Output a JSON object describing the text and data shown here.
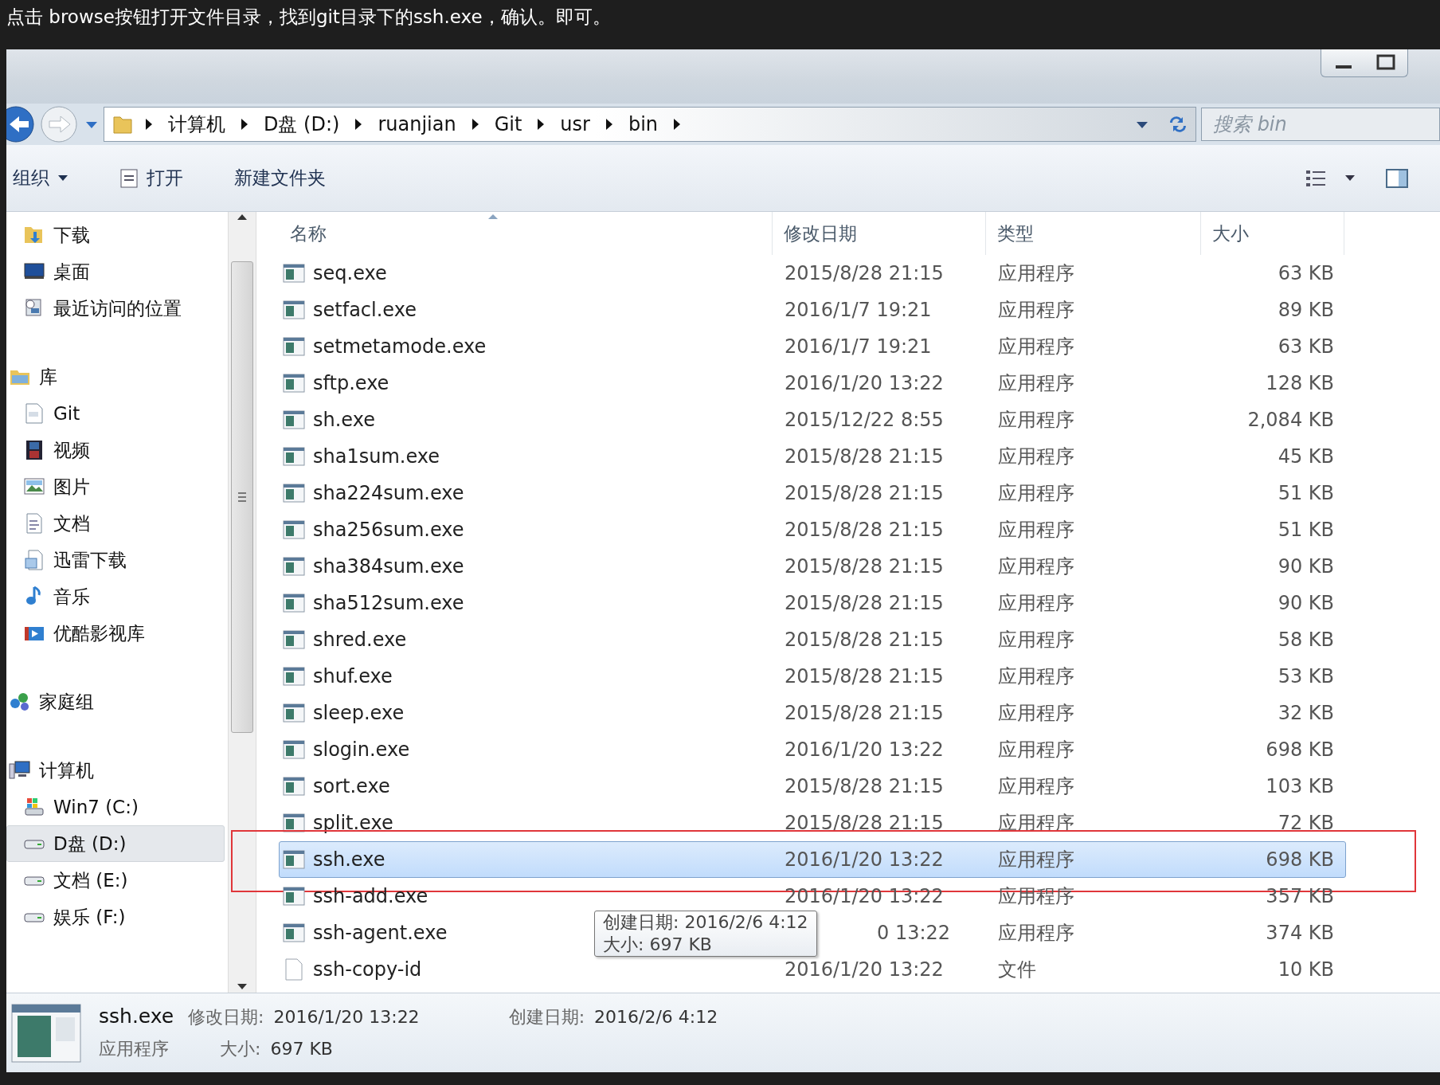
{
  "caption": "点击 browse按钮打开文件目录，找到git目录下的ssh.exe，确认。即可。",
  "address_bar": {
    "breadcrumbs": [
      "计算机",
      "D盘 (D:)",
      "ruanjian",
      "Git",
      "usr",
      "bin"
    ],
    "search": {
      "placeholder": "搜索 bin"
    }
  },
  "toolbar": {
    "buttons": [
      "组织",
      "打开",
      "新建文件夹"
    ]
  },
  "sidebar": {
    "items": [
      {
        "label": "下载",
        "kind": "item",
        "selected": false
      },
      {
        "label": "桌面",
        "kind": "item",
        "selected": false
      },
      {
        "label": "最近访问的位置",
        "kind": "item",
        "selected": false
      },
      {
        "label": "库",
        "kind": "group",
        "selected": false
      },
      {
        "label": "Git",
        "kind": "item",
        "selected": false
      },
      {
        "label": "视频",
        "kind": "item",
        "selected": false
      },
      {
        "label": "图片",
        "kind": "item",
        "selected": false
      },
      {
        "label": "文档",
        "kind": "item",
        "selected": false
      },
      {
        "label": "迅雷下载",
        "kind": "item",
        "selected": false
      },
      {
        "label": "音乐",
        "kind": "item",
        "selected": false
      },
      {
        "label": "优酷影视库",
        "kind": "item",
        "selected": false
      },
      {
        "label": "家庭组",
        "kind": "group",
        "selected": false
      },
      {
        "label": "计算机",
        "kind": "group",
        "selected": false
      },
      {
        "label": "Win7 (C:)",
        "kind": "item",
        "selected": false
      },
      {
        "label": "D盘 (D:)",
        "kind": "item",
        "selected": true
      },
      {
        "label": "文档 (E:)",
        "kind": "item",
        "selected": false
      },
      {
        "label": "娱乐 (F:)",
        "kind": "item",
        "selected": false
      }
    ]
  },
  "file_list": {
    "columns": [
      "名称",
      "修改日期",
      "类型",
      "大小"
    ],
    "rows": [
      {
        "name": "seq.exe",
        "date": "2015/8/28 21:15",
        "type": "应用程序",
        "size": "63 KB",
        "kind": "exe",
        "selected": false
      },
      {
        "name": "setfacl.exe",
        "date": "2016/1/7 19:21",
        "type": "应用程序",
        "size": "89 KB",
        "kind": "exe",
        "selected": false
      },
      {
        "name": "setmetamode.exe",
        "date": "2016/1/7 19:21",
        "type": "应用程序",
        "size": "63 KB",
        "kind": "exe",
        "selected": false
      },
      {
        "name": "sftp.exe",
        "date": "2016/1/20 13:22",
        "type": "应用程序",
        "size": "128 KB",
        "kind": "exe",
        "selected": false
      },
      {
        "name": "sh.exe",
        "date": "2015/12/22 8:55",
        "type": "应用程序",
        "size": "2,084 KB",
        "kind": "exe",
        "selected": false
      },
      {
        "name": "sha1sum.exe",
        "date": "2015/8/28 21:15",
        "type": "应用程序",
        "size": "45 KB",
        "kind": "exe",
        "selected": false
      },
      {
        "name": "sha224sum.exe",
        "date": "2015/8/28 21:15",
        "type": "应用程序",
        "size": "51 KB",
        "kind": "exe",
        "selected": false
      },
      {
        "name": "sha256sum.exe",
        "date": "2015/8/28 21:15",
        "type": "应用程序",
        "size": "51 KB",
        "kind": "exe",
        "selected": false
      },
      {
        "name": "sha384sum.exe",
        "date": "2015/8/28 21:15",
        "type": "应用程序",
        "size": "90 KB",
        "kind": "exe",
        "selected": false
      },
      {
        "name": "sha512sum.exe",
        "date": "2015/8/28 21:15",
        "type": "应用程序",
        "size": "90 KB",
        "kind": "exe",
        "selected": false
      },
      {
        "name": "shred.exe",
        "date": "2015/8/28 21:15",
        "type": "应用程序",
        "size": "58 KB",
        "kind": "exe",
        "selected": false
      },
      {
        "name": "shuf.exe",
        "date": "2015/8/28 21:15",
        "type": "应用程序",
        "size": "53 KB",
        "kind": "exe",
        "selected": false
      },
      {
        "name": "sleep.exe",
        "date": "2015/8/28 21:15",
        "type": "应用程序",
        "size": "32 KB",
        "kind": "exe",
        "selected": false
      },
      {
        "name": "slogin.exe",
        "date": "2016/1/20 13:22",
        "type": "应用程序",
        "size": "698 KB",
        "kind": "exe",
        "selected": false
      },
      {
        "name": "sort.exe",
        "date": "2015/8/28 21:15",
        "type": "应用程序",
        "size": "103 KB",
        "kind": "exe",
        "selected": false
      },
      {
        "name": "split.exe",
        "date": "2015/8/28 21:15",
        "type": "应用程序",
        "size": "72 KB",
        "kind": "exe",
        "selected": false
      },
      {
        "name": "ssh.exe",
        "date": "2016/1/20 13:22",
        "type": "应用程序",
        "size": "698 KB",
        "kind": "exe",
        "selected": true,
        "annotated": true
      },
      {
        "name": "ssh-add.exe",
        "date": "2016/1/20 13:22",
        "type": "应用程序",
        "size": "357 KB",
        "kind": "exe",
        "selected": false
      },
      {
        "name": "ssh-agent.exe",
        "date": "0 13:22",
        "type": "应用程序",
        "size": "374 KB",
        "kind": "exe",
        "selected": false,
        "tooltip": [
          "创建日期: 2016/2/6 4:12",
          "大小: 697 KB"
        ]
      },
      {
        "name": "ssh-copy-id",
        "date": "2016/1/20 13:22",
        "type": "文件",
        "size": "10 KB",
        "kind": "file",
        "selected": false
      }
    ]
  },
  "details": {
    "name": "ssh.exe",
    "type": "应用程序",
    "fields": [
      {
        "label": "修改日期:",
        "value": "2016/1/20 13:22"
      },
      {
        "label": "创建日期:",
        "value": "2016/2/6 4:12"
      },
      {
        "label": "大小:",
        "value": "697 KB"
      }
    ]
  }
}
